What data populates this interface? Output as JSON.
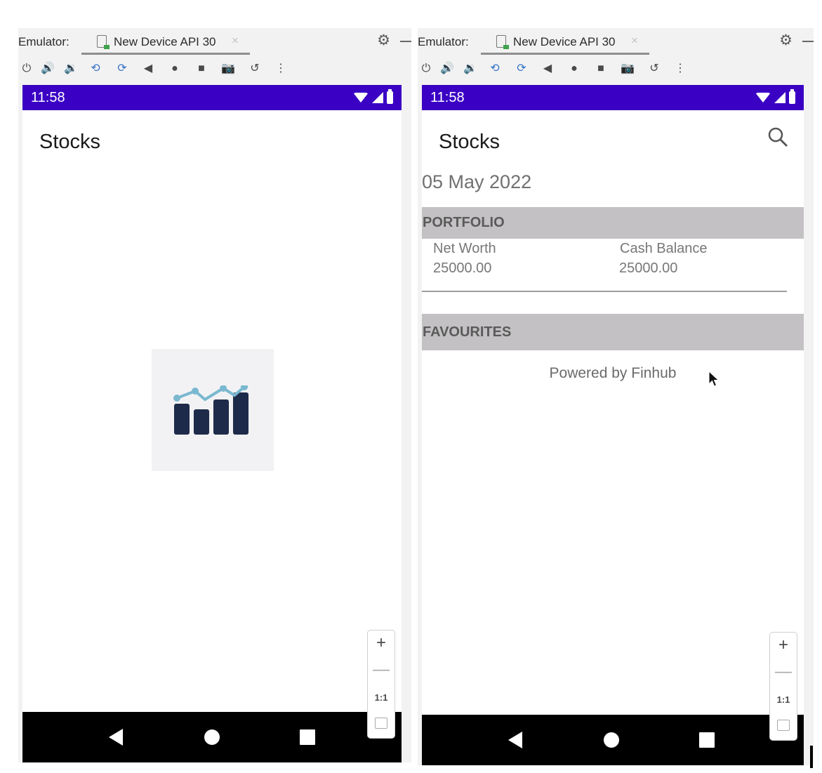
{
  "left": {
    "tabbar": {
      "emulator_label": "Emulator:",
      "tab_title": "New Device API 30",
      "close_glyph": "×"
    },
    "statusbar": {
      "time": "11:58"
    },
    "app": {
      "title": "Stocks"
    },
    "zoom": {
      "plus": "+",
      "minus": "—",
      "fit": "1:1"
    }
  },
  "right": {
    "tabbar": {
      "emulator_label": "Emulator:",
      "tab_title": "New Device API 30",
      "close_glyph": "×"
    },
    "statusbar": {
      "time": "11:58"
    },
    "app": {
      "title": "Stocks",
      "date": "05 May 2022",
      "portfolio": {
        "header": "PORTFOLIO",
        "net_worth_label": "Net Worth",
        "net_worth_value": "25000.00",
        "cash_balance_label": "Cash Balance",
        "cash_balance_value": "25000.00"
      },
      "favourites": {
        "header": "FAVOURITES"
      },
      "footer": "Powered by Finhub"
    },
    "zoom": {
      "plus": "+",
      "minus": "—",
      "fit": "1:1"
    }
  },
  "toolbar_icons": [
    "power-icon",
    "volume-up-icon",
    "volume-down-icon",
    "rotate-left-icon",
    "rotate-right-icon",
    "back-icon",
    "home-icon",
    "overview-icon",
    "screenshot-icon",
    "snapshot-icon",
    "more-icon"
  ],
  "colors": {
    "status_bar": "#3a00c4",
    "section_header": "#c3c1c3",
    "logo_bars": "#1e2a4a",
    "logo_line": "#7ab8d0"
  }
}
